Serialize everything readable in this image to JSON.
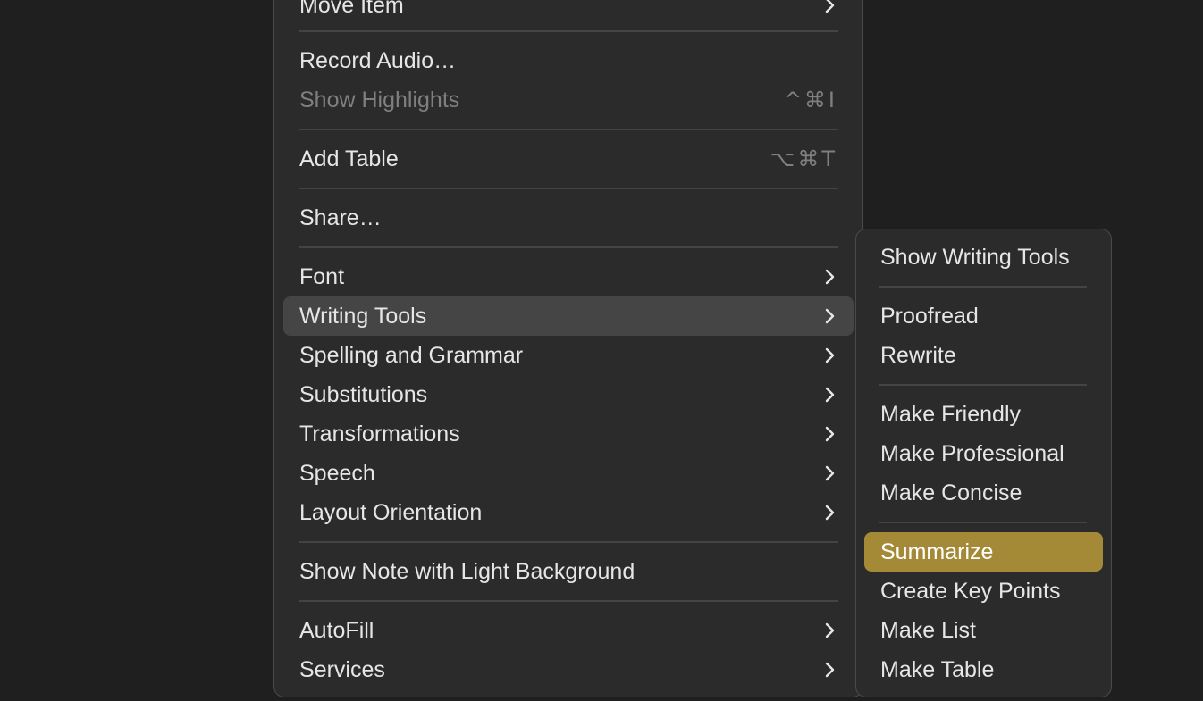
{
  "main_menu": {
    "items": [
      {
        "label": "Move Item",
        "has_submenu": true
      },
      {
        "label": "Record Audio…"
      },
      {
        "label": "Show Highlights",
        "shortcut": "^⌘I",
        "disabled": true
      },
      {
        "label": "Add Table",
        "shortcut": "⌥⌘T"
      },
      {
        "label": "Share…"
      },
      {
        "label": "Font",
        "has_submenu": true
      },
      {
        "label": "Writing Tools",
        "has_submenu": true,
        "highlighted": true
      },
      {
        "label": "Spelling and Grammar",
        "has_submenu": true
      },
      {
        "label": "Substitutions",
        "has_submenu": true
      },
      {
        "label": "Transformations",
        "has_submenu": true
      },
      {
        "label": "Speech",
        "has_submenu": true
      },
      {
        "label": "Layout Orientation",
        "has_submenu": true
      },
      {
        "label": "Show Note with Light Background"
      },
      {
        "label": "AutoFill",
        "has_submenu": true
      },
      {
        "label": "Services",
        "has_submenu": true
      }
    ]
  },
  "writing_tools_submenu": {
    "items": [
      {
        "label": "Show Writing Tools"
      },
      {
        "label": "Proofread"
      },
      {
        "label": "Rewrite"
      },
      {
        "label": "Make Friendly"
      },
      {
        "label": "Make Professional"
      },
      {
        "label": "Make Concise"
      },
      {
        "label": "Summarize",
        "selected": true
      },
      {
        "label": "Create Key Points"
      },
      {
        "label": "Make List"
      },
      {
        "label": "Make Table"
      }
    ]
  },
  "colors": {
    "background": "#1f1f1f",
    "menu_background": "#2b2b2b",
    "hover": "#454545",
    "selected_accent": "#a48a37",
    "text": "#e6e6e6",
    "disabled_text": "#7f7f7f"
  }
}
